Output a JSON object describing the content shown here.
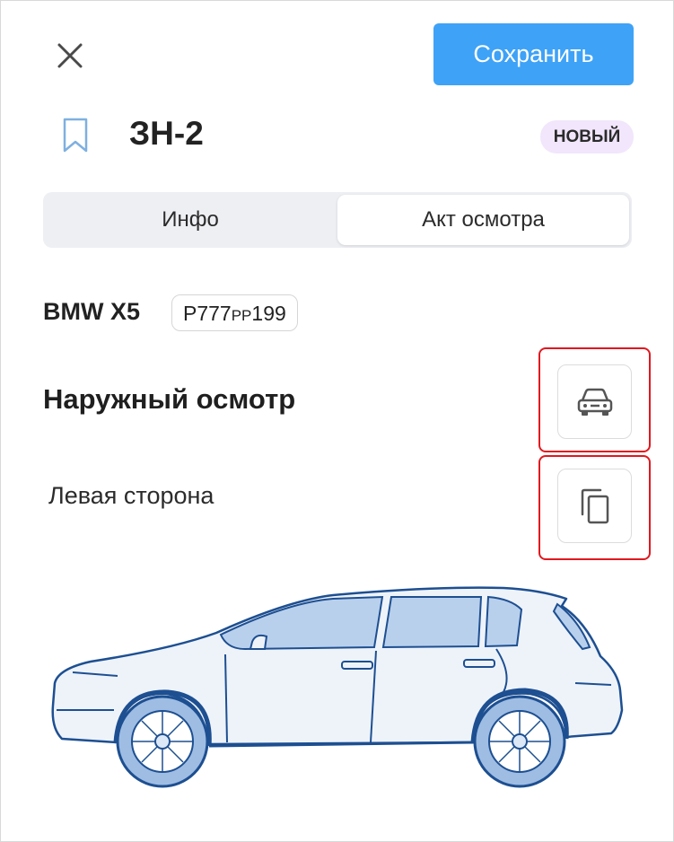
{
  "header": {
    "save_label": "Сохранить",
    "title": "ЗН-2",
    "status_badge": "НОВЫЙ"
  },
  "tabs": [
    {
      "label": "Инфо",
      "active": false
    },
    {
      "label": "Акт осмотра",
      "active": true
    }
  ],
  "vehicle": {
    "model": "BMW X5",
    "plate_main": "Р777",
    "plate_region_letters": "РР",
    "plate_region": "199"
  },
  "inspection": {
    "section_title": "Наружный осмотр",
    "side_label": "Левая сторона"
  },
  "icons": {
    "close": "close-icon",
    "bookmark": "bookmark-icon",
    "car_view": "car-front-icon",
    "copy": "copy-icon"
  },
  "colors": {
    "accent": "#3ea2f7",
    "badge_bg": "#f1e6fb",
    "highlight": "#e0181f",
    "car_fill": "#dce8f6",
    "car_stroke": "#1d4f91"
  }
}
